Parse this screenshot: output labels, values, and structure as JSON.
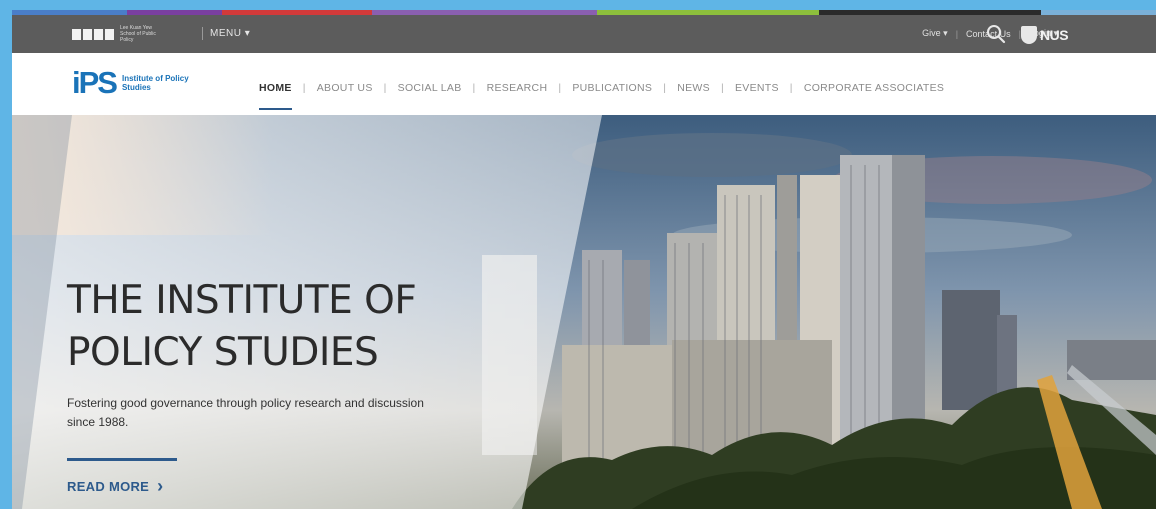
{
  "colors": {
    "frame": "#5fb5e6",
    "utility_bar": "#5c5c5c",
    "brand_blue": "#1a73b8",
    "accent_navy": "#2d5a8c",
    "stripe": [
      "#4a7ec8",
      "#7a3fa0",
      "#d23a3a",
      "#8a5fb0",
      "#5c5c5c",
      "#8dbf3c",
      "#2a2a2a",
      "#7ab0d8"
    ]
  },
  "utility": {
    "logo_caption": "Lee Kuan Yew School of Public Policy",
    "menu_label": "MENU",
    "menu_icon": "chevron-down-icon",
    "give_label": "Give",
    "contact_label": "Contact Us",
    "login_label": "Login",
    "search_icon": "search-icon",
    "nus_label": "NUS"
  },
  "brand": {
    "logo_mark": "iPS",
    "logo_text": "Institute of Policy Studies"
  },
  "nav": {
    "items": [
      {
        "label": "HOME"
      },
      {
        "label": "ABOUT US"
      },
      {
        "label": "SOCIAL LAB"
      },
      {
        "label": "RESEARCH"
      },
      {
        "label": "PUBLICATIONS"
      },
      {
        "label": "NEWS"
      },
      {
        "label": "EVENTS"
      },
      {
        "label": "CORPORATE ASSOCIATES"
      }
    ],
    "active": "HOME",
    "separator": "|"
  },
  "hero": {
    "title_line1": "THE INSTITUTE OF",
    "title_line2": "POLICY STUDIES",
    "subtitle": "Fostering good governance through policy research and discussion since 1988.",
    "cta_label": "READ MORE",
    "cta_icon": "chevron-right-icon"
  }
}
